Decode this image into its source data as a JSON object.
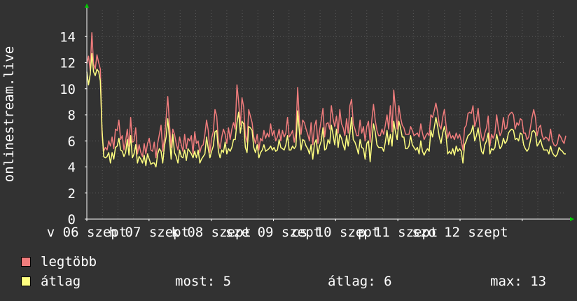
{
  "colors": {
    "background": "#323232",
    "grid": "#5a5a5a",
    "axis": "#ffffff",
    "arrow": "#00cc00",
    "series_max": "#f07c7c",
    "series_avg": "#ffff80"
  },
  "legend": {
    "max_label": "legtöbb",
    "avg_label": "átlag"
  },
  "stats": {
    "now": "most: 5",
    "avg": "átlag: 6",
    "max": "max: 13"
  },
  "chart_data": {
    "type": "line",
    "ylabel": "onlinestream.live",
    "ylim": [
      0,
      16
    ],
    "yticks": [
      0,
      2,
      4,
      6,
      8,
      10,
      12,
      14
    ],
    "grid": true,
    "x_tick_labels": [
      "v 06 szept",
      "h 07 szept",
      "k 08 szept",
      "sze 09 szept",
      "cs 10 szept",
      "p 11 szept",
      "szo 12 szept"
    ],
    "x_range_days": [
      0,
      7.7
    ],
    "legend_position": "bottom-left",
    "series": [
      {
        "name": "legtöbb",
        "values": [
          11.9,
          12.5,
          11.4,
          14.3,
          11.9,
          11.5,
          12.6,
          12.0,
          11.5,
          6.5,
          5.2,
          5.5,
          5.3,
          6.0,
          5.6,
          6.3,
          5.4,
          6.9,
          6.8,
          7.6,
          6.1,
          6.4,
          5.3,
          6.0,
          6.9,
          5.6,
          7.8,
          5.9,
          6.0,
          7.0,
          5.0,
          5.7,
          5.1,
          4.8,
          5.8,
          5.0,
          5.8,
          6.2,
          5.3,
          5.2,
          5.9,
          4.7,
          5.8,
          6.5,
          7.2,
          5.2,
          6.2,
          7.7,
          9.4,
          7.3,
          5.5,
          6.9,
          6.5,
          5.8,
          5.3,
          6.3,
          5.7,
          5.2,
          6.5,
          5.4,
          6.2,
          6.0,
          6.4,
          5.0,
          6.7,
          5.8,
          6.0,
          5.1,
          5.6,
          5.7,
          6.5,
          7.6,
          6.8,
          5.1,
          6.2,
          6.7,
          8.4,
          7.9,
          6.0,
          5.4,
          6.3,
          6.9,
          6.5,
          5.8,
          7.0,
          6.1,
          6.9,
          7.4,
          6.9,
          10.3,
          9.0,
          7.2,
          9.3,
          8.6,
          6.4,
          5.9,
          8.4,
          7.9,
          7.4,
          6.3,
          5.8,
          6.5,
          5.3,
          6.2,
          6.0,
          6.8,
          6.2,
          6.6,
          6.3,
          7.3,
          6.4,
          6.8,
          6.0,
          6.3,
          6.9,
          6.0,
          6.8,
          6.3,
          6.6,
          7.8,
          6.3,
          6.5,
          6.8,
          5.9,
          6.7,
          10.1,
          7.6,
          6.5,
          7.6,
          7.4,
          6.9,
          6.5,
          6.0,
          7.4,
          5.7,
          7.1,
          7.6,
          5.8,
          6.8,
          7.6,
          8.5,
          6.3,
          7.3,
          7.4,
          6.9,
          8.7,
          7.7,
          7.1,
          7.9,
          6.6,
          8.4,
          7.3,
          7.0,
          6.4,
          7.7,
          6.6,
          8.7,
          9.2,
          7.3,
          6.9,
          6.4,
          6.4,
          7.6,
          6.6,
          7.1,
          6.0,
          7.1,
          7.5,
          5.9,
          7.6,
          8.8,
          7.6,
          6.8,
          6.4,
          6.4,
          6.9,
          6.5,
          7.2,
          8.0,
          6.9,
          8.7,
          6.7,
          9.9,
          8.5,
          6.9,
          8.7,
          7.8,
          7.2,
          7.0,
          6.5,
          6.5,
          6.5,
          7.1,
          6.8,
          6.4,
          6.5,
          6.6,
          6.3,
          7.3,
          6.6,
          6.1,
          6.4,
          6.6,
          6.4,
          8.0,
          7.8,
          8.3,
          8.9,
          8.2,
          7.2,
          6.9,
          7.8,
          8.4,
          7.2,
          6.2,
          6.7,
          6.2,
          6.4,
          6.1,
          6.6,
          6.2,
          6.5,
          6.0,
          5.3,
          7.0,
          7.2,
          8.1,
          8.2,
          8.1,
          8.7,
          7.1,
          7.6,
          8.5,
          7.1,
          6.3,
          6.0,
          6.6,
          7.0,
          7.9,
          5.6,
          6.5,
          6.2,
          6.6,
          8.0,
          7.0,
          6.4,
          6.7,
          7.8,
          6.9,
          7.0,
          7.9,
          8.1,
          8.2,
          8.0,
          6.9,
          7.4,
          7.2,
          7.7,
          7.6,
          6.6,
          6.6,
          6.1,
          6.3,
          7.0,
          7.8,
          8.4,
          7.8,
          6.4,
          7.0,
          7.2,
          6.4,
          6.1,
          6.3,
          6.2,
          6.0,
          6.9,
          6.0,
          5.7,
          5.6,
          5.8,
          6.5,
          6.3,
          6.0,
          5.8,
          6.4
        ]
      },
      {
        "name": "átlag",
        "values": [
          11.3,
          10.3,
          11.1,
          12.7,
          11.3,
          11.0,
          11.5,
          11.3,
          10.6,
          6.9,
          4.8,
          4.7,
          4.8,
          5.1,
          4.3,
          5.1,
          4.6,
          5.5,
          5.6,
          6.2,
          5.3,
          5.2,
          4.8,
          5.1,
          6.1,
          4.9,
          6.4,
          4.7,
          5.0,
          5.7,
          4.3,
          4.8,
          4.6,
          4.3,
          4.9,
          4.1,
          5.0,
          4.6,
          4.2,
          4.3,
          4.3,
          4.0,
          5.0,
          5.4,
          5.2,
          4.3,
          5.6,
          6.3,
          7.7,
          6.2,
          4.6,
          6.5,
          5.1,
          4.8,
          4.3,
          5.3,
          4.8,
          4.7,
          5.3,
          4.5,
          5.4,
          5.2,
          5.0,
          4.7,
          5.2,
          4.7,
          5.3,
          4.3,
          4.6,
          4.8,
          5.0,
          6.3,
          5.4,
          4.7,
          5.2,
          5.6,
          6.7,
          6.8,
          5.2,
          4.7,
          5.3,
          5.1,
          5.9,
          5.0,
          5.4,
          5.2,
          5.5,
          6.1,
          6.1,
          7.4,
          8.2,
          6.6,
          7.5,
          7.3,
          5.5,
          5.1,
          7.1,
          7.0,
          6.8,
          5.5,
          5.1,
          5.7,
          4.7,
          5.1,
          5.3,
          5.7,
          5.2,
          5.3,
          5.4,
          5.6,
          5.3,
          5.5,
          5.2,
          5.3,
          6.1,
          5.5,
          5.4,
          5.3,
          5.7,
          6.4,
          5.3,
          5.3,
          5.6,
          5.4,
          5.6,
          8.3,
          6.7,
          5.3,
          6.1,
          6.0,
          5.6,
          5.4,
          5.0,
          5.7,
          4.6,
          5.8,
          6.1,
          5.0,
          5.6,
          6.0,
          7.0,
          5.3,
          5.4,
          6.1,
          5.8,
          7.2,
          6.5,
          5.7,
          6.9,
          5.5,
          6.5,
          6.2,
          5.7,
          5.3,
          6.4,
          5.6,
          6.6,
          7.8,
          6.1,
          5.9,
          5.5,
          5.0,
          6.1,
          5.5,
          5.4,
          4.6,
          5.8,
          6.0,
          4.4,
          5.9,
          7.3,
          6.7,
          5.7,
          5.5,
          5.5,
          5.5,
          5.2,
          5.9,
          6.8,
          5.7,
          6.5,
          5.6,
          7.5,
          6.7,
          6.1,
          7.5,
          7.0,
          6.3,
          6.3,
          5.4,
          5.4,
          5.6,
          6.4,
          5.7,
          5.5,
          5.3,
          5.5,
          5.0,
          6.0,
          5.2,
          4.9,
          5.2,
          5.4,
          5.2,
          6.8,
          6.3,
          7.0,
          7.8,
          7.1,
          6.3,
          5.8,
          6.6,
          7.1,
          6.4,
          5.0,
          5.2,
          5.0,
          5.4,
          4.9,
          5.6,
          5.2,
          5.4,
          5.2,
          4.3,
          5.7,
          6.0,
          6.4,
          6.5,
          6.7,
          7.2,
          6.0,
          6.4,
          7.0,
          6.1,
          5.2,
          5.0,
          5.7,
          6.0,
          6.6,
          5.0,
          5.4,
          5.3,
          5.5,
          6.5,
          5.9,
          5.4,
          5.6,
          6.2,
          5.8,
          6.0,
          6.6,
          6.8,
          6.9,
          6.8,
          6.1,
          6.2,
          6.0,
          6.6,
          6.5,
          5.7,
          5.4,
          5.2,
          5.4,
          6.0,
          6.7,
          6.8,
          6.6,
          5.6,
          5.8,
          6.1,
          5.6,
          5.3,
          5.3,
          5.3,
          5.0,
          5.6,
          5.1,
          4.9,
          4.8,
          5.0,
          5.5,
          5.3,
          5.2,
          5.0,
          5.0
        ]
      }
    ]
  }
}
